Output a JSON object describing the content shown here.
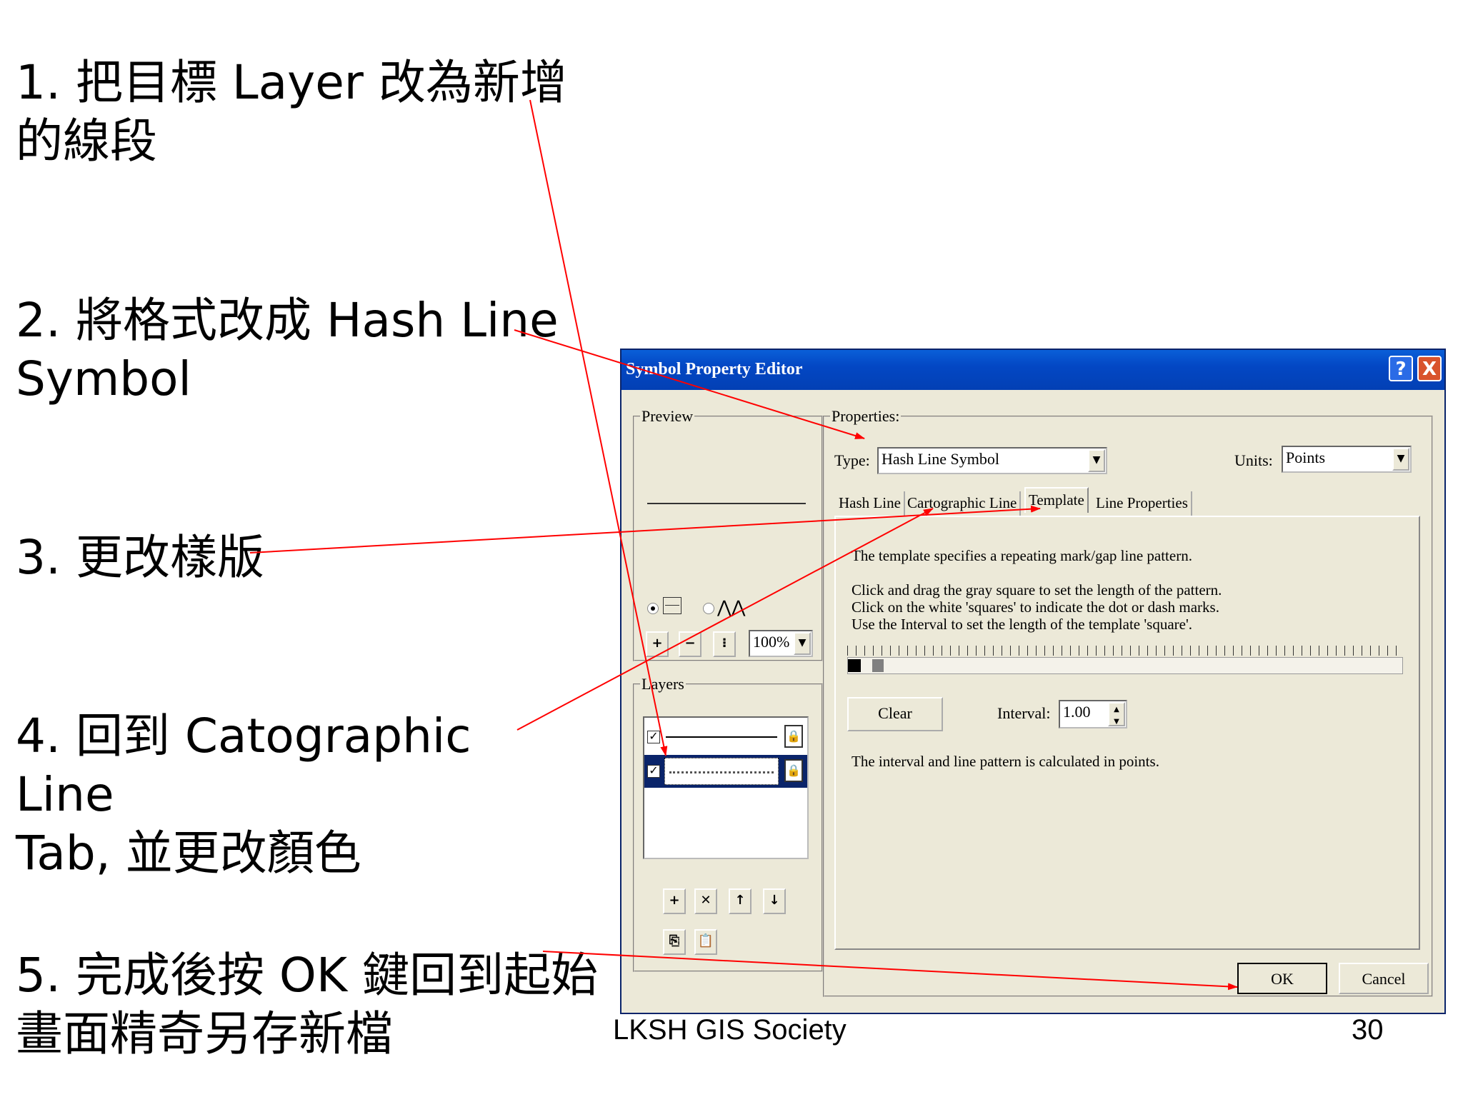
{
  "steps": [
    "1. 把目標 Layer 改為新增\n的線段",
    "2. 將格式改成 Hash Line\nSymbol",
    "3. 更改樣版",
    "4. 回到 Catographic Line\nTab, 並更改顏色",
    "5. 完成後按 OK 鍵回到起始\n畫面精奇另存新檔"
  ],
  "footer": {
    "left": "LKSH  GIS Society",
    "page": "30"
  },
  "dialog": {
    "title": "Symbol Property Editor",
    "help": "?",
    "close": "X",
    "preview_label": "Preview",
    "zoom": "100%",
    "layers_label": "Layers",
    "properties_label": "Properties:",
    "type_label": "Type:",
    "type_value": "Hash Line Symbol",
    "units_label": "Units:",
    "units_value": "Points",
    "tabs": [
      "Hash Line",
      "Cartographic Line",
      "Template",
      "Line Properties"
    ],
    "template_desc": "The template specifies a repeating mark/gap line pattern.",
    "instructions": [
      "Click and drag the gray square to set the length of the pattern.",
      "Click on the white 'squares' to indicate the dot or dash marks.",
      "Use the Interval to set the length of the template 'square'."
    ],
    "clear": "Clear",
    "interval_label": "Interval:",
    "interval_value": "1.00",
    "note": "The interval and line pattern is calculated in points.",
    "ok": "OK",
    "cancel": "Cancel"
  },
  "colors": {
    "arrow": "#ff0000",
    "titlebar": "#0a5fd8",
    "dialog_bg": "#ece9d8",
    "selected_layer": "#0a246a"
  },
  "icons": [
    "help-icon",
    "close-icon",
    "zoom-in-icon",
    "zoom-out-icon",
    "fit-icon",
    "lock-icon",
    "checkbox-icon",
    "add-icon",
    "delete-icon",
    "up-arrow-icon",
    "down-arrow-icon",
    "copy-icon",
    "paste-icon"
  ]
}
